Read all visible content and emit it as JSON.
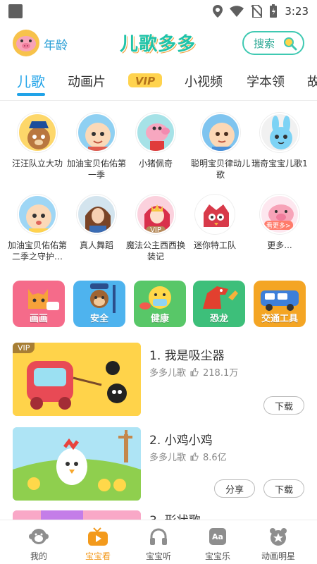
{
  "status_bar": {
    "time": "3:23"
  },
  "header": {
    "age_label": "年龄",
    "logo_text": "儿歌多多",
    "search_label": "搜索"
  },
  "tabs": [
    {
      "label": "儿歌"
    },
    {
      "label": "动画片"
    },
    {
      "label": "VIP"
    },
    {
      "label": "小视频"
    },
    {
      "label": "学本领"
    },
    {
      "label": "故"
    }
  ],
  "channels": [
    {
      "label": "汪汪队立大功",
      "icon": "puppy-character-icon"
    },
    {
      "label": "加油宝贝佑佑第一季",
      "icon": "baby-character-icon"
    },
    {
      "label": "小猪佩奇",
      "icon": "pig-character-icon"
    },
    {
      "label": "聪明宝贝律动儿歌",
      "icon": "smart-baby-icon"
    },
    {
      "label": "瑞奇宝宝儿歌1",
      "icon": "rabbit-character-icon"
    },
    {
      "label": "加油宝贝佑佑第二季之守护…",
      "icon": "baby-character-icon"
    },
    {
      "label": "真人舞蹈",
      "icon": "dancer-icon"
    },
    {
      "label": "魔法公主西西换装记",
      "icon": "princess-icon",
      "badge": "VIP"
    },
    {
      "label": "迷你特工队",
      "icon": "robot-bird-icon"
    },
    {
      "label": "更多...",
      "icon": "pink-pig-icon",
      "badge": "看更多>"
    }
  ],
  "categories": [
    {
      "label": "画画",
      "color": "#f56b8a"
    },
    {
      "label": "安全",
      "color": "#4eb3ee"
    },
    {
      "label": "健康",
      "color": "#58c768"
    },
    {
      "label": "恐龙",
      "color": "#3dbf7a"
    },
    {
      "label": "交通工具",
      "color": "#f4a524"
    }
  ],
  "videos": [
    {
      "title": "1. 我是吸尘器",
      "channel": "多多儿歌",
      "plays": "218.1万",
      "vip": "VIP",
      "download": "下载"
    },
    {
      "title": "2. 小鸡小鸡",
      "channel": "多多儿歌",
      "plays": "8.6亿",
      "share": "分享",
      "download": "下载"
    },
    {
      "title": "3. 形状歌"
    }
  ],
  "bottom_nav": [
    {
      "label": "我的",
      "icon": "monkey-face-icon"
    },
    {
      "label": "宝宝看",
      "icon": "play-tv-icon",
      "active": true
    },
    {
      "label": "宝宝听",
      "icon": "headphones-icon"
    },
    {
      "label": "宝宝乐",
      "icon": "games-icon"
    },
    {
      "label": "动画明星",
      "icon": "bear-star-icon"
    }
  ],
  "colors": {
    "accent": "#21a3e8",
    "active_nav": "#f39a1c",
    "search_border": "#3fc9b2"
  }
}
